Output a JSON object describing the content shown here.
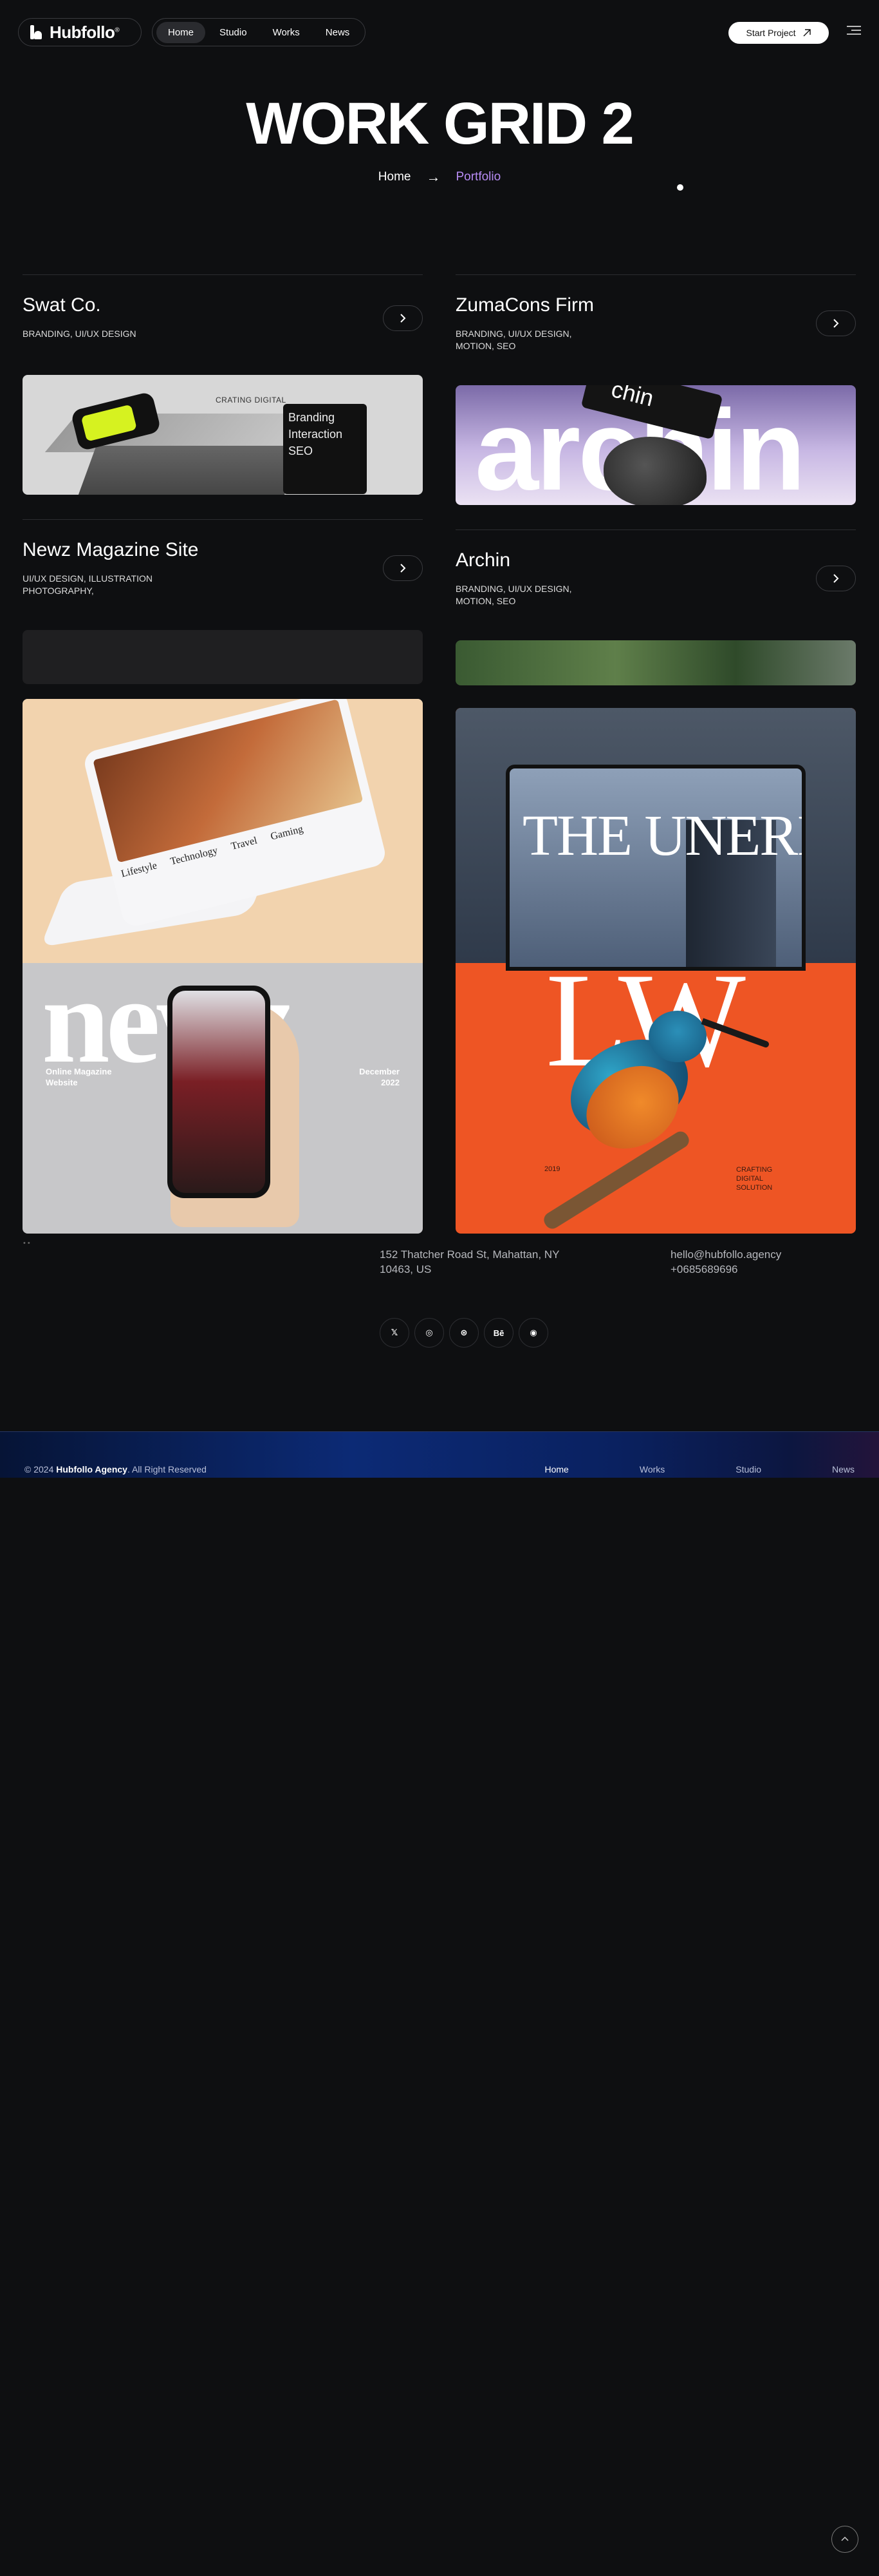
{
  "header": {
    "logo": "Hubfollo",
    "logo_mark": "®",
    "nav": [
      "Home",
      "Studio",
      "Works",
      "News"
    ],
    "active_nav": "Home",
    "cta": "Start Project",
    "icons": {
      "logo": "hubfollo-logo-icon",
      "cta": "arrow-up-right-icon",
      "menu": "hamburger-menu-icon"
    }
  },
  "hero": {
    "title": "WORK GRID 2",
    "breadcrumb": {
      "home": "Home",
      "separator": "→",
      "current": "Portfolio"
    },
    "accent_color": "#b78bf4"
  },
  "projects": [
    {
      "title": "Swat Co.",
      "tags": "BRANDING, UI/UX DESIGN",
      "image_text": [
        "CRATING DIGITAL",
        "Branding",
        "Interaction",
        "SEO"
      ]
    },
    {
      "title": "ZumaCons Firm",
      "tags": "BRANDING, UI/UX DESIGN, MOTION, SEO",
      "image_text": [
        "archin",
        "chin"
      ]
    },
    {
      "title": "Newz Magazine Site",
      "tags": "UI/UX DESIGN, ILLUSTRATION PHOTOGRAPHY,",
      "image_text": [
        "newz",
        "Online Magazine",
        "Website",
        "December",
        "2022",
        "Lifestyle",
        "Technology",
        "Travel",
        "Gaming"
      ]
    },
    {
      "title": "Archin",
      "tags": "BRANDING, UI/UX DESIGN, MOTION, SEO",
      "image_text": [
        "THE UNERIO",
        "LW",
        "2019",
        "CRAFTING",
        "DIGITAL",
        "SOLUTION"
      ]
    }
  ],
  "contact": {
    "address_line1": "152 Thatcher Road St, Mahattan, NY",
    "address_line2": "10463, US",
    "email": "hello@hubfollo.agency",
    "phone": "+0685689696",
    "stub": "• •"
  },
  "social": [
    {
      "icon": "x-twitter-icon",
      "label": "𝕏"
    },
    {
      "icon": "instagram-icon",
      "label": "◎"
    },
    {
      "icon": "dribbble-icon",
      "label": "⊛"
    },
    {
      "icon": "behance-icon",
      "label": "Bē"
    },
    {
      "icon": "github-icon",
      "label": "◉"
    }
  ],
  "footer": {
    "copy_prefix": "© 2024",
    "copy_brand": "Hubfollo Agency",
    "copy_suffix": ". All Right Reserved",
    "nav": [
      "Home",
      "Works",
      "Studio",
      "News"
    ],
    "active": "Home"
  },
  "back_to_top_icon": "chevron-up-icon"
}
